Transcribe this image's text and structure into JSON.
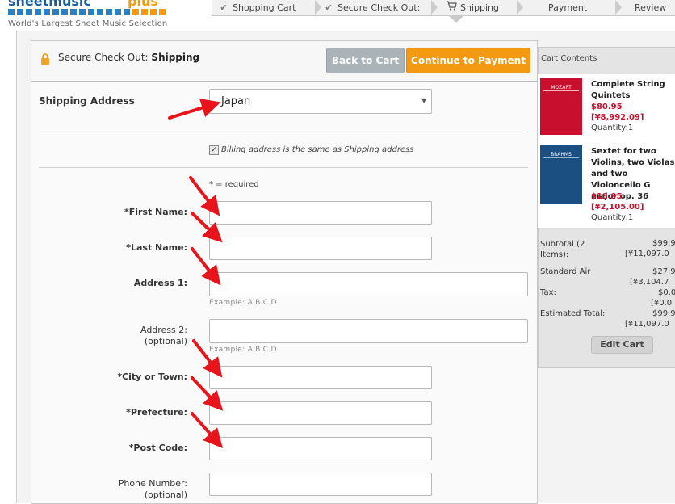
{
  "brand": {
    "tagline": "World's Largest Sheet Music Selection",
    "logo_text": "sheetmusic",
    "logo_plus": "plus",
    "accent_color": "#f39a12",
    "brand_blue": "#2a7fc1"
  },
  "steps": [
    {
      "label": "Shopping Cart",
      "icon": "check-icon",
      "state": "done"
    },
    {
      "label": "Secure Check Out:",
      "icon": "check-icon",
      "state": "done"
    },
    {
      "label": "Shipping",
      "icon": "cart-icon",
      "state": "current"
    },
    {
      "label": "Payment",
      "icon": "",
      "state": "upcoming"
    },
    {
      "label": "Review",
      "icon": "",
      "state": "upcoming"
    }
  ],
  "panel": {
    "title_prefix": "Secure Check Out: ",
    "title_strong": "Shipping",
    "back_label": "Back to Cart",
    "continue_label": "Continue to Payment"
  },
  "form": {
    "shipping_address_label": "Shipping Address",
    "country_value": "Japan",
    "billing_same_label": "Billing address is the same as Shipping address",
    "billing_same_checked": true,
    "required_note": "* = required",
    "first_name_label": "*First Name:",
    "last_name_label": "*Last Name:",
    "address1_label": "Address 1:",
    "address1_hint": "Example: A.B.C.D",
    "address2_label": "Address 2:",
    "address2_optional": "(optional)",
    "address2_hint": "Example: A.B.C.D",
    "city_label": "*City or Town:",
    "prefecture_label": "*Prefecture:",
    "postcode_label": "*Post Code:",
    "phone_label": "Phone Number:",
    "phone_optional": "(optional)",
    "first_name_value": "",
    "last_name_value": "",
    "address1_value": "",
    "address2_value": "",
    "city_value": "",
    "prefecture_value": "",
    "postcode_value": "",
    "phone_value": ""
  },
  "cart": {
    "title": "Cart Contents",
    "items": [
      {
        "title": "Complete String Quintets",
        "price_usd": "$80.95",
        "price_yen": "[¥8,992.09]",
        "qty": "Quantity:1",
        "cover_text": "MOZART",
        "cover_color": "#c8102e"
      },
      {
        "title": "Sextet for two Violins, two Violas and two Violoncello G major op. 36",
        "price_usd": "$18.95",
        "price_yen": "[¥2,105.00]",
        "qty": "Quantity:1",
        "cover_text": "BRAHMS",
        "cover_color": "#1b4f82"
      }
    ],
    "subtotal_label": "Subtotal (2 Items):",
    "subtotal_usd": "$99.9",
    "subtotal_yen": "[¥11,097.0",
    "shipping_label": "Standard Air",
    "shipping_usd": "$27.9",
    "shipping_yen": "[¥3,104.7",
    "tax_label": "Tax:",
    "tax_usd": "$0.0",
    "tax_yen": "[¥0.0",
    "total_label": "Estimated Total:",
    "total_usd": "$99.9",
    "total_yen": "[¥11,097.0",
    "edit_label": "Edit Cart"
  }
}
